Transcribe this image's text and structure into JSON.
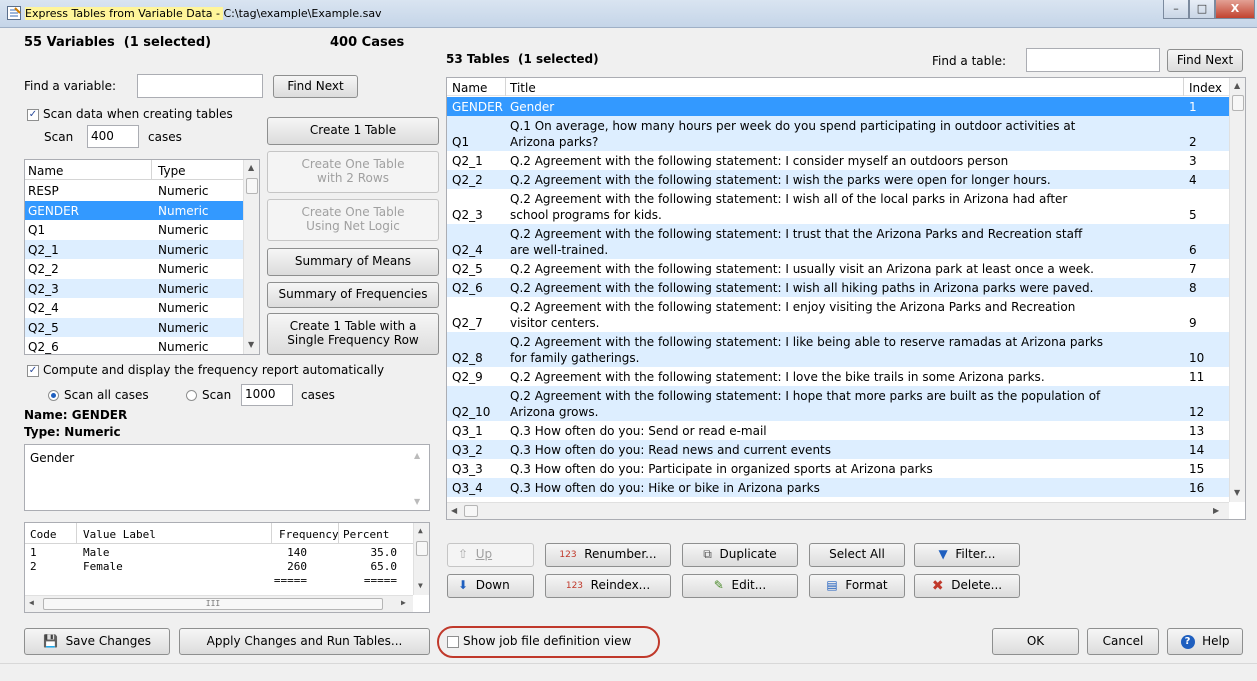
{
  "window": {
    "title_prefix": "Express Tables from Variable Data - ",
    "title_path": "C:\\tag\\example\\Example.sav",
    "buttons": [
      "–",
      "□",
      "X"
    ]
  },
  "left": {
    "var_count": "55 Variables",
    "var_selected": "(1 selected)",
    "cases": "400 Cases",
    "find_label": "Find a variable:",
    "find_value": "",
    "find_next": "Find Next",
    "scan_check_label": "Scan data when creating tables",
    "scan_label": "Scan",
    "scan_value": "400",
    "scan_cases": "cases",
    "var_headers": [
      "Name",
      "Type"
    ],
    "variables": [
      {
        "name": "RESP",
        "type": "Numeric"
      },
      {
        "name": "GENDER",
        "type": "Numeric"
      },
      {
        "name": "Q1",
        "type": "Numeric"
      },
      {
        "name": "Q2_1",
        "type": "Numeric"
      },
      {
        "name": "Q2_2",
        "type": "Numeric"
      },
      {
        "name": "Q2_3",
        "type": "Numeric"
      },
      {
        "name": "Q2_4",
        "type": "Numeric"
      },
      {
        "name": "Q2_5",
        "type": "Numeric"
      },
      {
        "name": "Q2_6",
        "type": "Numeric"
      }
    ],
    "buttons": {
      "create1": "Create 1 Table",
      "create2a": "Create One Table",
      "create2b": "with 2 Rows",
      "create3a": "Create One Table",
      "create3b": "Using Net Logic",
      "means": "Summary of Means",
      "freqs": "Summary of Frequencies",
      "single_a": "Create 1 Table with a",
      "single_b": "Single Frequency Row"
    },
    "compute_label": "Compute and display the frequency report automatically",
    "scan_all": "Scan all cases",
    "scan_n_label": "Scan",
    "scan_n_value": "1000",
    "scan_n_cases": "cases",
    "name_line": "Name: GENDER",
    "type_line": "Type: Numeric",
    "description": "Gender",
    "freq_headers": [
      "Code",
      "Value Label",
      "Frequency",
      "Percent"
    ],
    "freq_rows": [
      {
        "code": "1",
        "label": "Male",
        "freq": "140",
        "pct": "35.0"
      },
      {
        "code": "2",
        "label": "Female",
        "freq": "260",
        "pct": "65.0"
      },
      {
        "code": "",
        "label": "",
        "freq": "=====",
        "pct": "====="
      }
    ],
    "hscroll_grip": "III"
  },
  "right": {
    "tab_count": "53 Tables",
    "tab_selected": "(1 selected)",
    "find_label": "Find a table:",
    "find_value": "",
    "find_next": "Find Next",
    "headers": [
      "Name",
      "Title",
      "Index"
    ],
    "tables": [
      {
        "name": "GENDER",
        "l1": "Gender",
        "l2": "",
        "idx": "1"
      },
      {
        "name": "Q1",
        "l1": "Q.1 On average, how many hours per week do you spend participating in outdoor activities at",
        "l2": "Arizona parks?",
        "idx": "2"
      },
      {
        "name": "Q2_1",
        "l1": "Q.2 Agreement with the following statement: I consider myself an outdoors person",
        "l2": "",
        "idx": "3"
      },
      {
        "name": "Q2_2",
        "l1": "Q.2 Agreement with the following statement: I wish the parks were open for longer hours.",
        "l2": "",
        "idx": "4"
      },
      {
        "name": "Q2_3",
        "l1": "Q.2 Agreement with the following statement: I wish all of the local parks in Arizona had after",
        "l2": "school programs for kids.",
        "idx": "5"
      },
      {
        "name": "Q2_4",
        "l1": "Q.2 Agreement with the following statement: I trust that the Arizona Parks and Recreation staff",
        "l2": "are well-trained.",
        "idx": "6"
      },
      {
        "name": "Q2_5",
        "l1": "Q.2 Agreement with the following statement: I usually visit an Arizona park at least once a week.",
        "l2": "",
        "idx": "7"
      },
      {
        "name": "Q2_6",
        "l1": "Q.2 Agreement with the following statement: I wish all hiking paths in Arizona parks were paved.",
        "l2": "",
        "idx": "8"
      },
      {
        "name": "Q2_7",
        "l1": "Q.2 Agreement with the following statement: I enjoy visiting the Arizona Parks and Recreation",
        "l2": "visitor centers.",
        "idx": "9"
      },
      {
        "name": "Q2_8",
        "l1": "Q.2 Agreement with the following statement: I like being able to reserve ramadas at Arizona parks",
        "l2": "for family gatherings.",
        "idx": "10"
      },
      {
        "name": "Q2_9",
        "l1": "Q.2 Agreement with the following statement: I love the bike trails in some Arizona parks.",
        "l2": "",
        "idx": "11"
      },
      {
        "name": "Q2_10",
        "l1": "Q.2 Agreement with the following statement: I hope that more parks are built as the population of",
        "l2": "Arizona grows.",
        "idx": "12"
      },
      {
        "name": "Q3_1",
        "l1": "Q.3 How often do you: Send or read e-mail",
        "l2": "",
        "idx": "13"
      },
      {
        "name": "Q3_2",
        "l1": "Q.3 How often do you: Read news and current events",
        "l2": "",
        "idx": "14"
      },
      {
        "name": "Q3_3",
        "l1": "Q.3 How often do you: Participate in organized sports at Arizona parks",
        "l2": "",
        "idx": "15"
      },
      {
        "name": "Q3_4",
        "l1": "Q.3 How often do you: Hike or bike in Arizona parks",
        "l2": "",
        "idx": "16"
      }
    ],
    "actions": {
      "up": "Up",
      "down": "Down",
      "renumber": "Renumber...",
      "reindex": "Reindex...",
      "duplicate": "Duplicate",
      "edit": "Edit...",
      "select_all": "Select All",
      "format": "Format",
      "filter": "Filter...",
      "delete": "Delete..."
    },
    "numglyph": "123"
  },
  "bottom": {
    "save": "Save Changes",
    "apply": "Apply Changes and Run Tables...",
    "show_job": "Show job file definition view",
    "ok": "OK",
    "cancel": "Cancel",
    "help": "Help"
  },
  "colors": {
    "selection": "#3399ff",
    "alternate": "#ddeeff",
    "highlight_circle": "#c0392b"
  }
}
